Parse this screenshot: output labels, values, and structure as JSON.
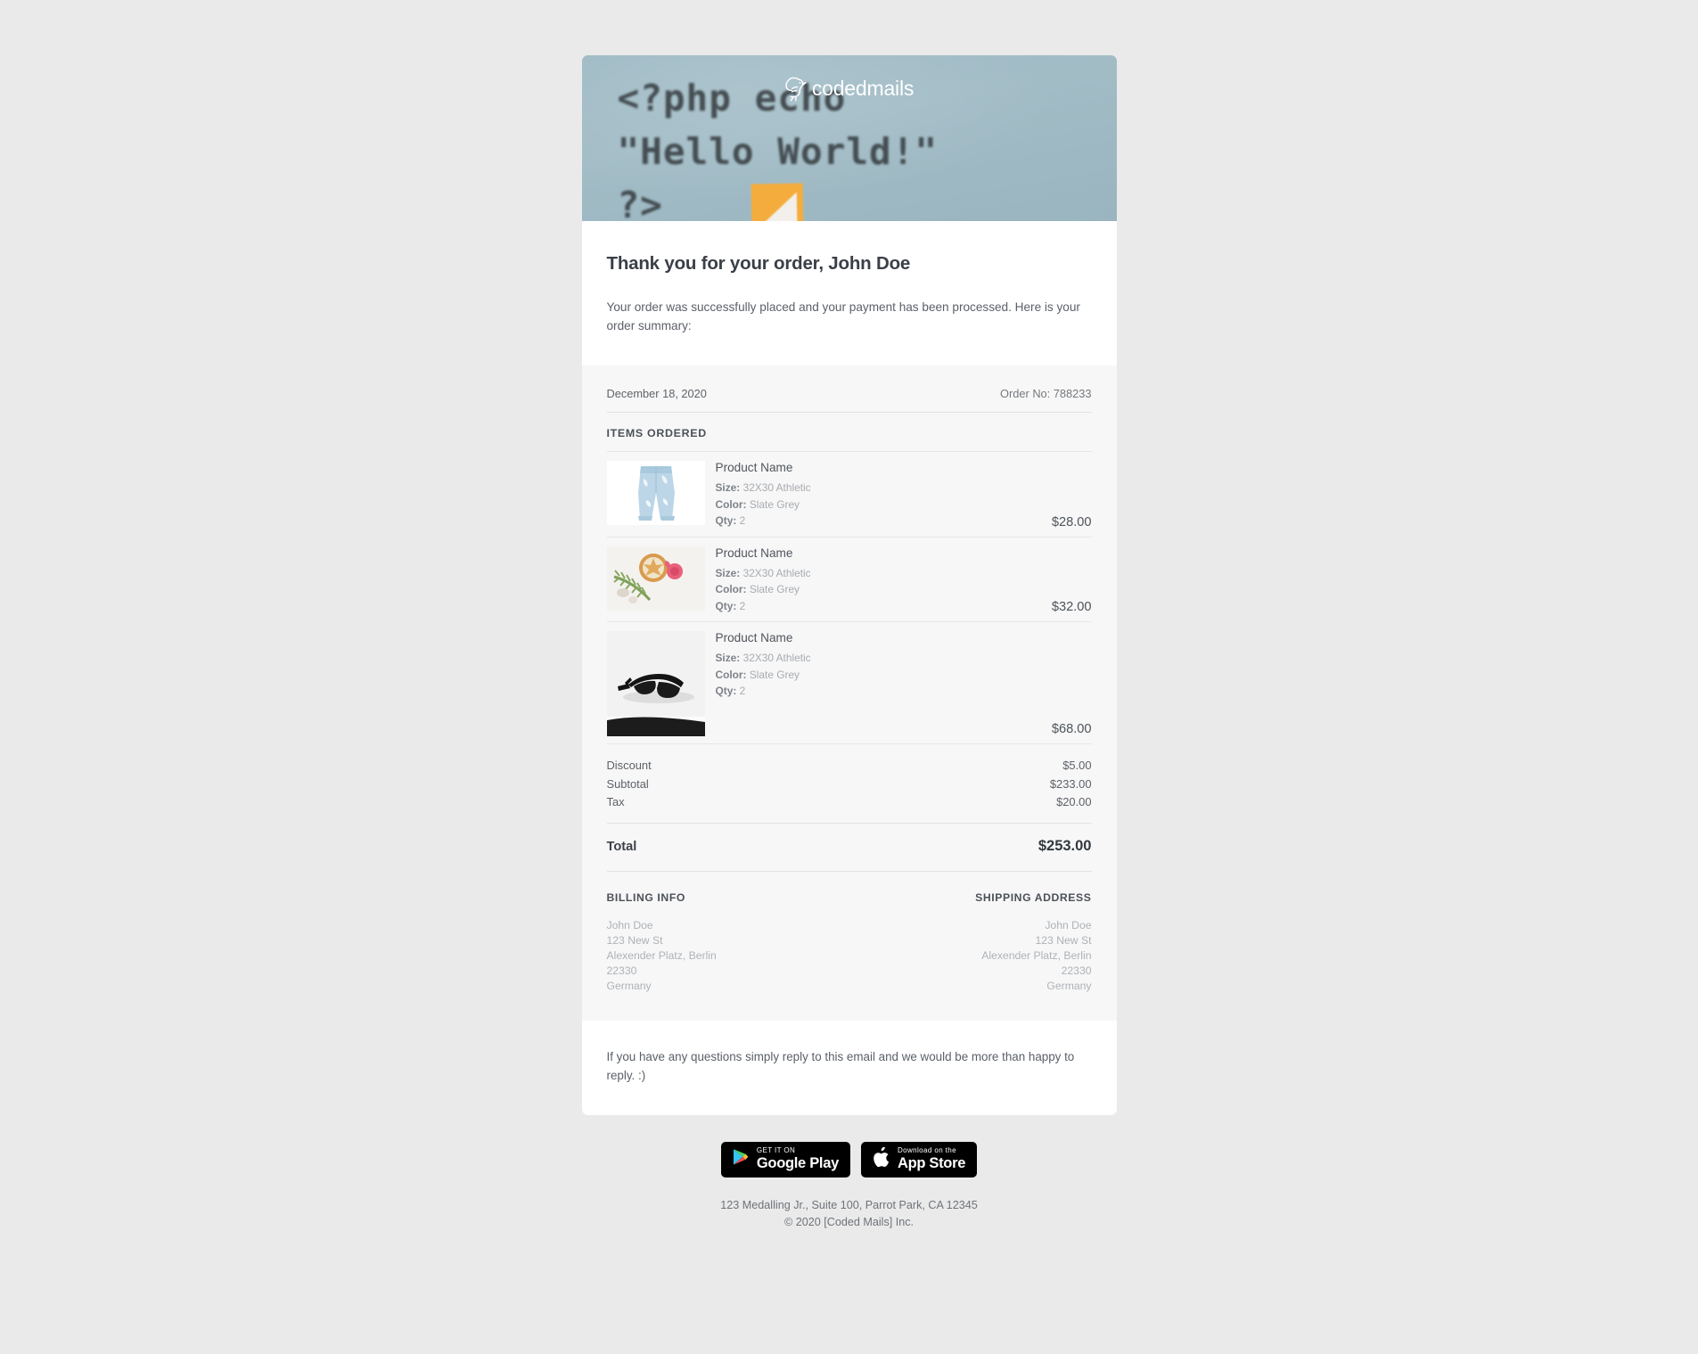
{
  "brand": {
    "logo_text": "codedmails",
    "logo_icon": "bird-icon"
  },
  "hero": {
    "code_line_1": "<?php echo",
    "code_line_2": "\"Hello World!\"",
    "code_line_3": "?>"
  },
  "intro": {
    "title": "Thank you for your order, John Doe",
    "body": "Your order was successfully placed and your payment has been processed. Here is your order summary:"
  },
  "order": {
    "date": "December 18, 2020",
    "order_no": "Order No: 788233",
    "items_heading": "ITEMS ORDERED",
    "items": [
      {
        "name": "Product Name",
        "size_label": "Size:",
        "size_value": "32X30 Athletic",
        "color_label": "Color:",
        "color_value": "Slate Grey",
        "qty_label": "Qty:",
        "qty_value": "2",
        "price": "$28.00",
        "image": "denim-shorts-photo"
      },
      {
        "name": "Product Name",
        "size_label": "Size:",
        "size_value": "32X30 Athletic",
        "color_label": "Color:",
        "color_value": "Slate Grey",
        "qty_label": "Qty:",
        "qty_value": "2",
        "price": "$32.00",
        "image": "floral-flatlay-photo"
      },
      {
        "name": "Product Name",
        "size_label": "Size:",
        "size_value": "32X30 Athletic",
        "color_label": "Color:",
        "color_value": "Slate Grey",
        "qty_label": "Qty:",
        "qty_value": "2",
        "price": "$68.00",
        "image": "sunglasses-photo"
      }
    ],
    "totals": [
      {
        "label": "Discount",
        "value": "$5.00"
      },
      {
        "label": "Subtotal",
        "value": "$233.00"
      },
      {
        "label": "Tax",
        "value": "$20.00"
      }
    ],
    "grand_total_label": "Total",
    "grand_total_value": "$253.00"
  },
  "billing": {
    "title": "BILLING INFO",
    "lines": [
      "John Doe",
      "123 New St",
      "Alexender Platz, Berlin",
      "22330",
      "Germany"
    ]
  },
  "shipping": {
    "title": "SHIPPING ADDRESS",
    "lines": [
      "John Doe",
      "123 New St",
      "Alexender Platz, Berlin",
      "22330",
      "Germany"
    ]
  },
  "outro": {
    "text": "If you have any questions simply reply to this email and we would be more than happy to reply. :)"
  },
  "footer": {
    "google_play": {
      "small": "GET IT ON",
      "big": "Google Play",
      "icon": "google-play-icon"
    },
    "app_store": {
      "small": "Download on the",
      "big": "App Store",
      "icon": "apple-logo-icon"
    },
    "address": "123 Medalling Jr., Suite 100, Parrot Park, CA 12345",
    "copyright": "© 2020 [Coded Mails] Inc."
  },
  "colors": {
    "page_bg": "#eaeaea",
    "card_bg": "#ffffff",
    "summary_bg": "#f7f7f7",
    "hero_bg": "#9cb7c2",
    "heading": "#3a3f47",
    "muted": "#a7abb0",
    "badge_bg": "#000000"
  }
}
